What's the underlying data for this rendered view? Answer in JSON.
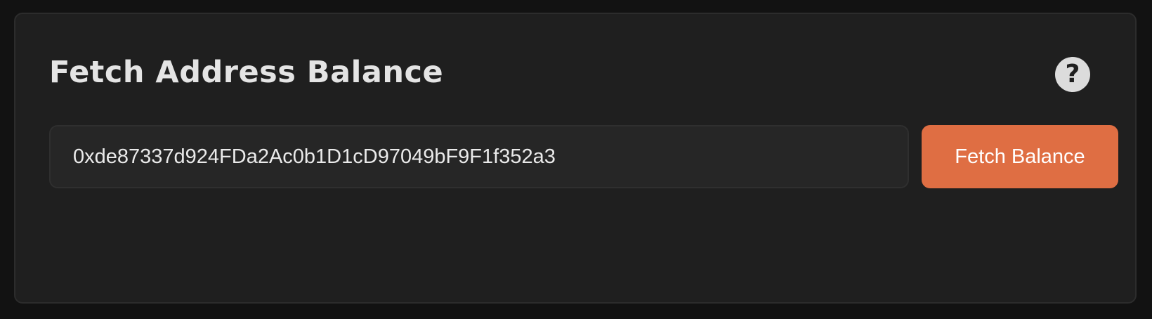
{
  "card": {
    "title": "Fetch Address Balance",
    "help_icon": "question-mark-circle",
    "help_glyph": "?"
  },
  "address_input": {
    "value": "0xde87337d924FDa2Ac0b1D1cD97049bF9F1f352a3",
    "placeholder": ""
  },
  "fetch_button": {
    "label": "Fetch Balance"
  },
  "colors": {
    "page_background": "#121212",
    "card_background": "#1f1f1f",
    "accent": "#df6e43",
    "text": "#e4e4e4"
  }
}
